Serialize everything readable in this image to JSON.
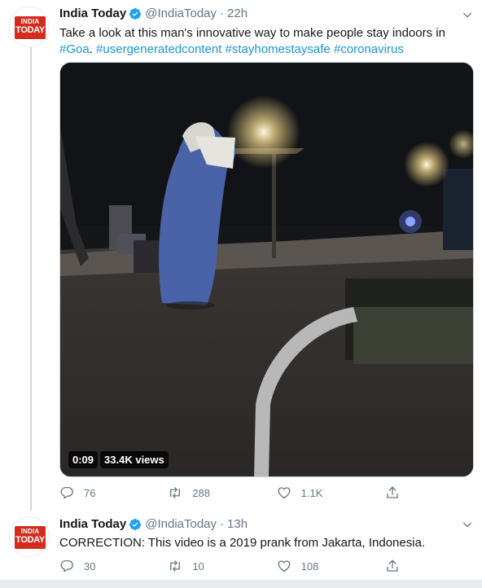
{
  "tweets": [
    {
      "name": "India Today",
      "handle": "@IndiaToday",
      "time": "22h",
      "avatar": {
        "line1": "INDIA",
        "line2": "TODAY",
        "color": "#d52b1e"
      },
      "text": "Take a look at this man's innovative way to make people stay indoors in ",
      "hashtags": [
        "#Goa",
        "#usergeneratedcontent",
        "#stayhomestaysafe",
        "#coronavirus"
      ],
      "video": {
        "duration": "0:09",
        "views": "33.4K views"
      },
      "actions": {
        "replies": "76",
        "retweets": "288",
        "likes": "1.1K"
      }
    },
    {
      "name": "India Today",
      "handle": "@IndiaToday",
      "time": "13h",
      "avatar": {
        "line1": "INDIA",
        "line2": "TODAY",
        "color": "#d52b1e"
      },
      "text": "CORRECTION: This video is a 2019 prank from Jakarta, Indonesia.",
      "actions": {
        "replies": "30",
        "retweets": "10",
        "likes": "108"
      }
    }
  ],
  "separator": "·",
  "colors": {
    "link": "#1b95e0",
    "verified": "#1da1f2",
    "muted": "#657786",
    "brand": "#d52b1e"
  }
}
